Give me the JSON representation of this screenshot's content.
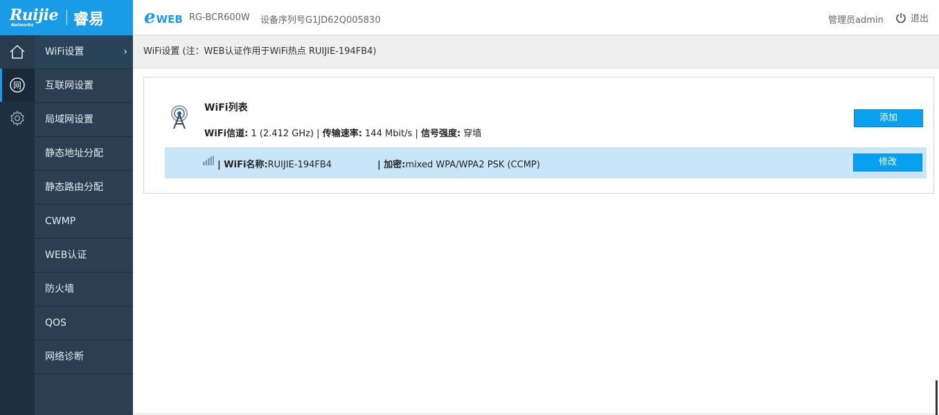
{
  "brand": {
    "logo_text": "Ruijie",
    "logo_sub": "Networks",
    "logo_cn": "睿易",
    "eweb_e": "e",
    "eweb_w": "WEB",
    "model": "RG-BCR600W",
    "serial": "设备序列号G1JD62Q005830"
  },
  "user": {
    "admin_label": "管理员admin",
    "logout_label": "退出"
  },
  "rail": {
    "home_icon": "home-icon",
    "network_icon": "network-icon",
    "network_char": "网",
    "settings_icon": "gear-icon"
  },
  "menu": {
    "items": [
      {
        "label": "WiFi设置"
      },
      {
        "label": "互联网设置"
      },
      {
        "label": "局域网设置"
      },
      {
        "label": "静态地址分配"
      },
      {
        "label": "静态路由分配"
      },
      {
        "label": "CWMP"
      },
      {
        "label": "WEB认证"
      },
      {
        "label": "防火墙"
      },
      {
        "label": "QOS"
      },
      {
        "label": "网络诊断"
      }
    ]
  },
  "breadcrumb": "WiFi设置 (注：WEB认证作用于WiFi热点 RUIJIE-194FB4)",
  "wifi_list": {
    "title": "WiFi列表",
    "channel_label": "WiFi信道:",
    "channel_value": " 1 (2.412 GHz) | ",
    "rate_label": "传输速率:",
    "rate_value": " 144 Mbit/s | ",
    "strength_label": "信号强度:",
    "strength_value": " 穿墙",
    "add_button": "添加",
    "entries": [
      {
        "name_label": "| WiFi名称:",
        "name_value": "RUIJIE-194FB4",
        "enc_label": "| 加密:",
        "enc_value": "mixed WPA/WPA2 PSK (CCMP)",
        "edit_button": "修改"
      }
    ]
  },
  "colors": {
    "accent": "#1a9be8",
    "sidebar": "#2b3e52",
    "rail": "#1f2f41",
    "row_highlight": "#c8e6f7",
    "button": "#0aa0f0"
  }
}
